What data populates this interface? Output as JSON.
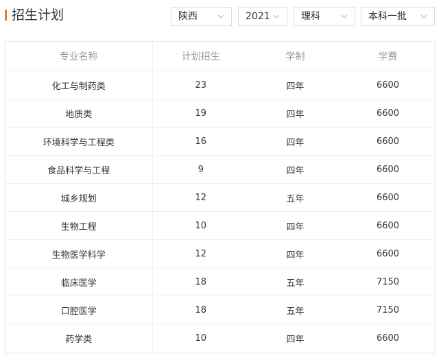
{
  "header": {
    "title": "招生计划",
    "accent_color": "#e8792c"
  },
  "filters": {
    "province": "陕西",
    "year": "2021",
    "category": "理科",
    "batch": "本科一批",
    "dropdown_icon": "chevron-down-icon"
  },
  "table": {
    "columns": [
      "专业名称",
      "计划招生",
      "学制",
      "学费"
    ],
    "rows": [
      [
        "化工与制药类",
        "23",
        "四年",
        "6600"
      ],
      [
        "地质类",
        "19",
        "四年",
        "6600"
      ],
      [
        "环境科学与工程类",
        "16",
        "四年",
        "6600"
      ],
      [
        "食品科学与工程",
        "9",
        "四年",
        "6600"
      ],
      [
        "城乡规划",
        "12",
        "五年",
        "6600"
      ],
      [
        "生物工程",
        "10",
        "四年",
        "6600"
      ],
      [
        "生物医学科学",
        "12",
        "四年",
        "6600"
      ],
      [
        "临床医学",
        "18",
        "五年",
        "7150"
      ],
      [
        "口腔医学",
        "18",
        "五年",
        "7150"
      ],
      [
        "药学类",
        "10",
        "四年",
        "6600"
      ]
    ]
  }
}
